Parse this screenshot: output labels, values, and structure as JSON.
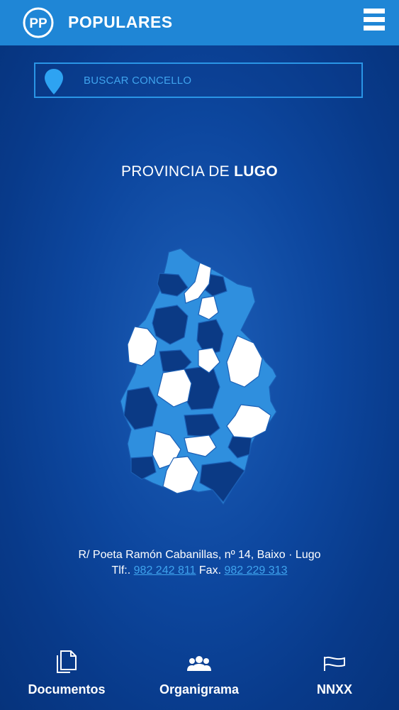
{
  "header": {
    "logo_text": "PP",
    "brand": "POPULARES",
    "menu_icon": "hamburger-menu-icon"
  },
  "search": {
    "icon": "location-pin-icon",
    "placeholder": "BUSCAR CONCELLO"
  },
  "province": {
    "prefix": "PROVINCIA DE ",
    "name": "LUGO"
  },
  "map": {
    "colors": {
      "light": "#2f8fde",
      "dark": "#0b3a85",
      "white": "#ffffff",
      "border": "#1b5fb5"
    }
  },
  "contact": {
    "address": "R/ Poeta Ramón Cabanillas, nº 14, Baixo · Lugo",
    "phone_label": "Tlf:.",
    "phone": "982 242 811",
    "fax_label": "Fax.",
    "fax": "982 229 313"
  },
  "bottom_nav": [
    {
      "label": "Documentos",
      "icon": "documents-icon"
    },
    {
      "label": "Organigrama",
      "icon": "people-group-icon"
    },
    {
      "label": "NNXX",
      "icon": "flag-icon"
    }
  ],
  "colors": {
    "header_bg": "#1f86d6",
    "accent": "#3fa4ee",
    "background": "#0d479f"
  }
}
